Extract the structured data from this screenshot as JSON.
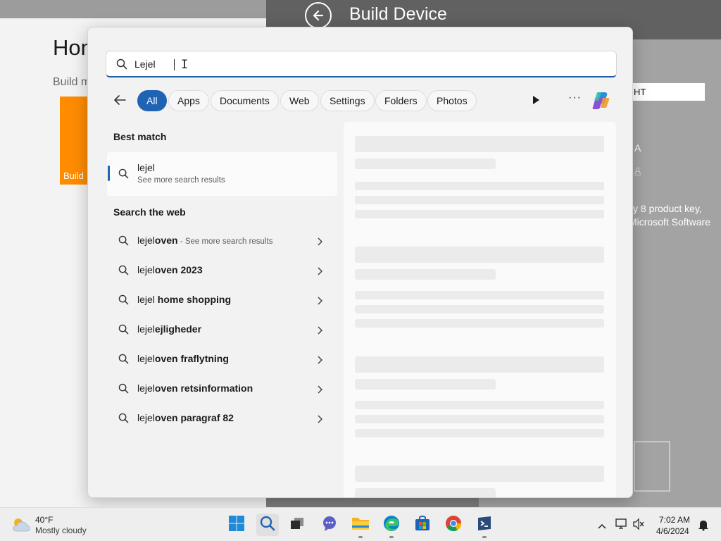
{
  "background_left": {
    "title": "Hon",
    "subtitle": "Build m",
    "tile_label": "Build"
  },
  "background_right": {
    "title": "Build Device",
    "input_value": "HT",
    "line_a1": "A",
    "line_a2": "A",
    "text1": "y 8 product key,",
    "text2": "Microsoft Software"
  },
  "search": {
    "query": "Lejel",
    "filters": [
      "All",
      "Apps",
      "Documents",
      "Web",
      "Settings",
      "Folders",
      "Photos"
    ],
    "active_filter": "All",
    "best_match_label": "Best match",
    "best_match": {
      "title": "lejel",
      "subtitle": "See more search results"
    },
    "web_label": "Search the web",
    "web_results": [
      {
        "prefix": "lejel",
        "rest": "oven",
        "sub": " - See more search results"
      },
      {
        "prefix": "lejel",
        "rest": "oven 2023",
        "sub": ""
      },
      {
        "prefix": "lejel",
        "rest": " home shopping",
        "sub": ""
      },
      {
        "prefix": "lejel",
        "rest": "ejligheder",
        "sub": ""
      },
      {
        "prefix": "lejel",
        "rest": "oven fraflytning",
        "sub": ""
      },
      {
        "prefix": "lejel",
        "rest": "oven retsinformation",
        "sub": ""
      },
      {
        "prefix": "lejel",
        "rest": "oven paragraf 82",
        "sub": ""
      }
    ]
  },
  "taskbar": {
    "weather_temp": "40°F",
    "weather_condition": "Mostly cloudy",
    "time": "7:02 AM",
    "date": "4/6/2024",
    "apps": [
      "start-icon",
      "search-icon",
      "task-view-icon",
      "chat-icon",
      "file-explorer-icon",
      "edge-icon",
      "store-icon",
      "chrome-icon",
      "terminal-icon"
    ]
  },
  "colors": {
    "accent": "#1f63b5",
    "orange_tile": "#ff8c00"
  }
}
